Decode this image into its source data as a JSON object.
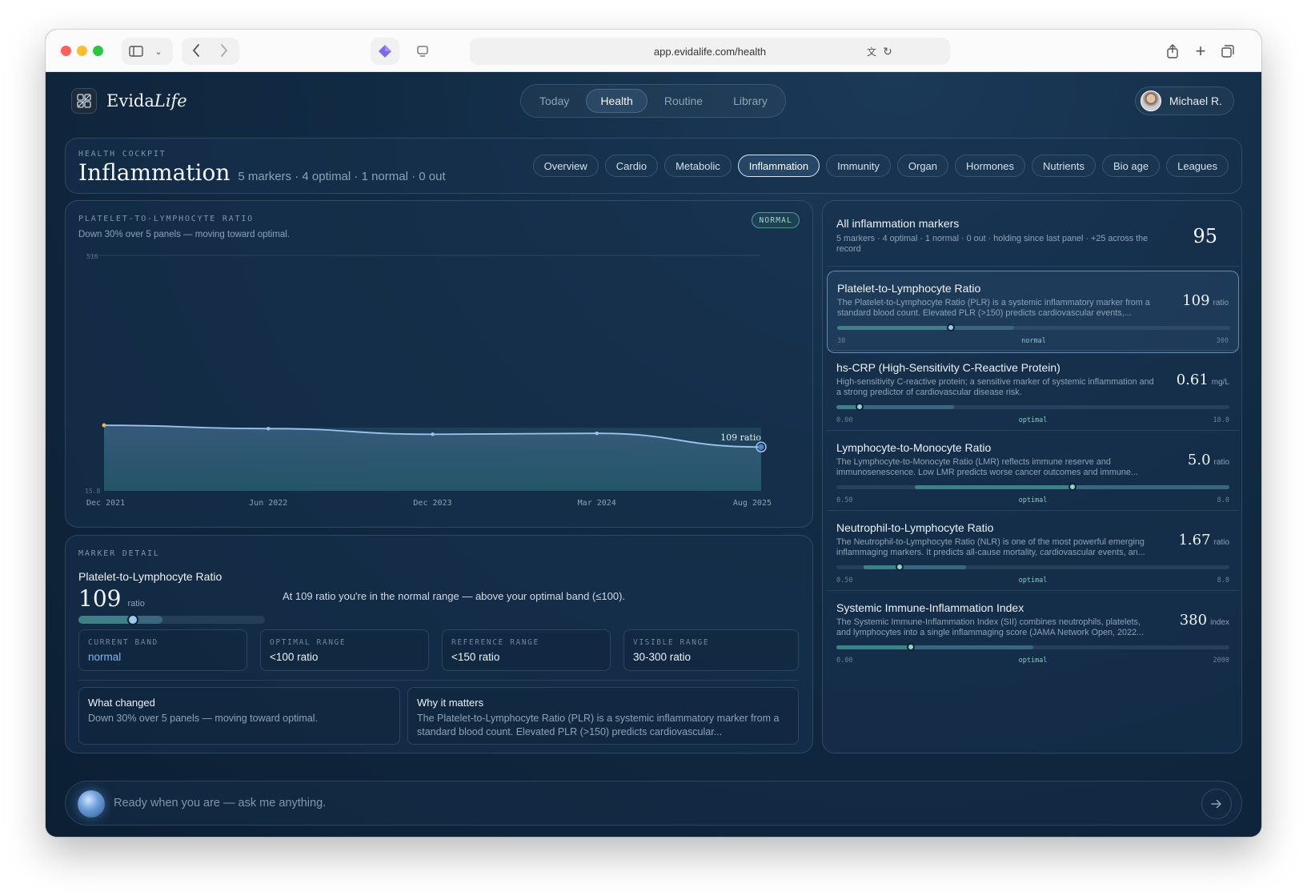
{
  "browser": {
    "url": "app.evidalife.com/health"
  },
  "brand": {
    "name_plain": "Evida",
    "name_italic": "Life"
  },
  "nav": {
    "tabs": [
      "Today",
      "Health",
      "Routine",
      "Library"
    ],
    "active": "Health"
  },
  "user": {
    "name": "Michael R."
  },
  "cockpit": {
    "eyebrow": "HEALTH COCKPIT",
    "title": "Inflammation",
    "summary": "5 markers · 4 optimal · 1 normal · 0 out",
    "tabs": [
      "Overview",
      "Cardio",
      "Metabolic",
      "Inflammation",
      "Immunity",
      "Organ",
      "Hormones",
      "Nutrients",
      "Bio age",
      "Leagues"
    ],
    "active_tab": "Inflammation"
  },
  "chart_panel": {
    "eyebrow": "PLATELET-TO-LYMPHOCYTE RATIO",
    "subtitle": "Down 30% over 5 panels — moving toward optimal.",
    "badge": "NORMAL"
  },
  "chart_data": {
    "type": "area",
    "x": [
      "Dec 2021",
      "Jun 2022",
      "Dec 2023",
      "Mar 2024",
      "Aug 2025"
    ],
    "values": [
      155,
      148,
      136,
      138,
      109
    ],
    "ylim": [
      15.8,
      516
    ],
    "ytick_labels": [
      "516",
      "15.8"
    ],
    "end_label": "109 ratio",
    "band": [
      15.8,
      150
    ],
    "colors": {
      "line": "#9cc4ee",
      "first_point": "#f0b24a",
      "band": "#2d6877"
    }
  },
  "detail": {
    "eyebrow": "MARKER DETAIL",
    "name": "Platelet-to-Lymphocyte Ratio",
    "value": "109",
    "unit": "ratio",
    "statement": "At 109 ratio you're in the normal range — above your optimal band (≤100).",
    "position_fraction": 0.29,
    "boxes": [
      {
        "label": "CURRENT BAND",
        "value": "normal"
      },
      {
        "label": "OPTIMAL RANGE",
        "value": "<100 ratio"
      },
      {
        "label": "REFERENCE RANGE",
        "value": "<150 ratio"
      },
      {
        "label": "VISIBLE RANGE",
        "value": "30-300 ratio"
      }
    ],
    "what_changed": {
      "title": "What changed",
      "text": "Down 30% over 5 panels — moving toward optimal."
    },
    "why_matters": {
      "title": "Why it matters",
      "text": "The Platelet-to-Lymphocyte Ratio (PLR) is a systemic inflammatory marker from a standard blood count. Elevated PLR (>150) predicts cardiovascular..."
    }
  },
  "markers": {
    "title": "All inflammation markers",
    "summary": "5 markers · 4 optimal · 1 normal · 0 out · holding since last panel · +25 across the record",
    "score": "95",
    "items": [
      {
        "name": "Platelet-to-Lymphocyte Ratio",
        "desc": "The Platelet-to-Lymphocyte Ratio (PLR) is a systemic inflammatory marker from a standard blood count. Elevated PLR (>150) predicts cardiovascular events,...",
        "value": "109",
        "unit": "ratio",
        "min": "30",
        "max": "300",
        "status": "normal",
        "position": 0.29,
        "band": [
          0,
          0.45
        ]
      },
      {
        "name": "hs-CRP (High-Sensitivity C-Reactive Protein)",
        "desc": "High-sensitivity C-reactive protein; a sensitive marker of systemic inflammation and a strong predictor of cardiovascular disease risk.",
        "value": "0.61",
        "unit": "mg/L",
        "min": "0.00",
        "max": "10.0",
        "status": "optimal",
        "position": 0.06,
        "band": [
          0,
          0.3
        ]
      },
      {
        "name": "Lymphocyte-to-Monocyte Ratio",
        "desc": "The Lymphocyte-to-Monocyte Ratio (LMR) reflects immune reserve and immunosenescence. Low LMR predicts worse cancer outcomes and immune...",
        "value": "5.0",
        "unit": "ratio",
        "min": "0.50",
        "max": "8.0",
        "status": "optimal",
        "position": 0.6,
        "band": [
          0.2,
          1.0
        ]
      },
      {
        "name": "Neutrophil-to-Lymphocyte Ratio",
        "desc": "The Neutrophil-to-Lymphocyte Ratio (NLR) is one of the most powerful emerging inflammaging markers. It predicts all-cause mortality, cardiovascular events, an...",
        "value": "1.67",
        "unit": "ratio",
        "min": "0.50",
        "max": "8.0",
        "status": "optimal",
        "position": 0.16,
        "band": [
          0.07,
          0.33
        ]
      },
      {
        "name": "Systemic Immune-Inflammation Index",
        "desc": "The Systemic Immune-Inflammation Index (SII) combines neutrophils, platelets, and lymphocytes into a single inflammaging score (JAMA Network Open, 2022...",
        "value": "380",
        "unit": "index",
        "min": "0.00",
        "max": "2000",
        "status": "optimal",
        "position": 0.19,
        "band": [
          0,
          0.5
        ]
      }
    ]
  },
  "chat": {
    "placeholder": "Ready when you are — ask me anything."
  }
}
